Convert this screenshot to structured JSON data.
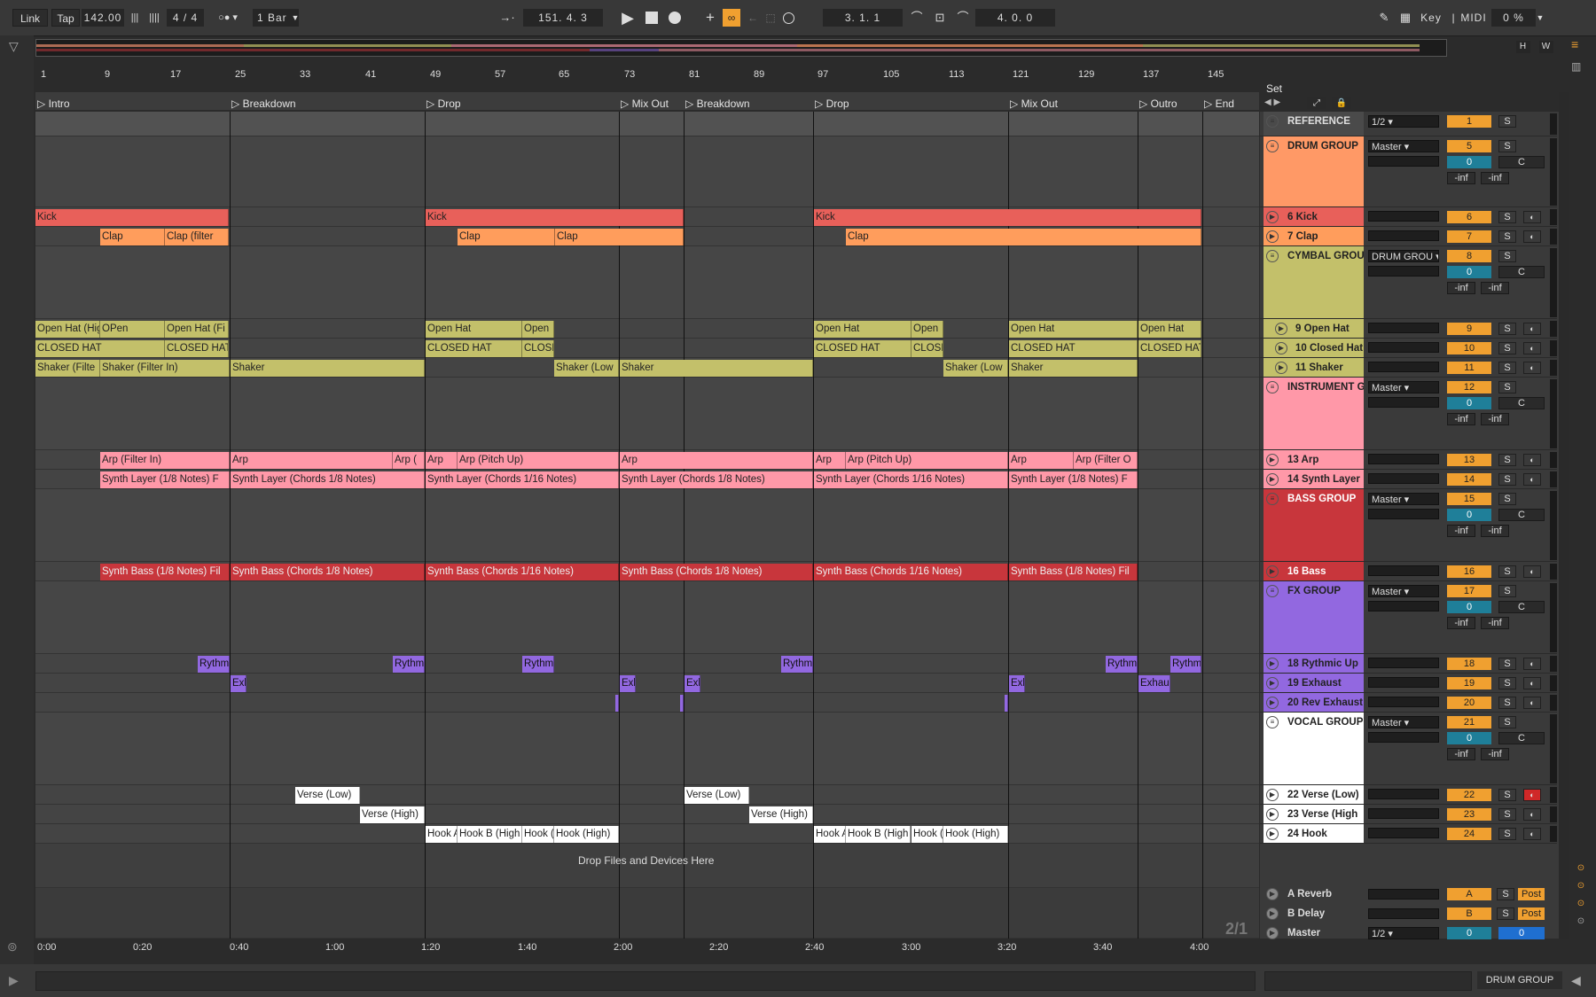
{
  "transport": {
    "link": "Link",
    "tap": "Tap",
    "tempo": "142.00",
    "signature": "4 / 4",
    "quantize": "1 Bar",
    "position": "151.   4.   3",
    "loop_start": "3.   1.   1",
    "loop_length": "4.   0.   0",
    "key": "Key",
    "midi": "MIDI",
    "cpu": "0 %",
    "overview_h": "H",
    "overview_w": "W"
  },
  "arrangement": {
    "set_label": "Set",
    "bars": [
      "1",
      "9",
      "17",
      "25",
      "33",
      "41",
      "49",
      "57",
      "65",
      "73",
      "81",
      "89",
      "97",
      "105",
      "113",
      "121",
      "129",
      "137",
      "145"
    ],
    "locators": [
      "Intro",
      "Breakdown",
      "Drop",
      "Mix Out",
      "Breakdown",
      "Drop",
      "Mix Out",
      "Outro",
      "End"
    ],
    "drop_hint": "Drop Files and Devices Here",
    "page_indicator": "2/1",
    "times": [
      "0:00",
      "0:20",
      "0:40",
      "1:00",
      "1:20",
      "1:40",
      "2:00",
      "2:20",
      "2:40",
      "3:00",
      "3:20",
      "3:40",
      "4:00"
    ]
  },
  "clips": {
    "kick": [
      "Kick",
      "Kick",
      "Kick"
    ],
    "clap": [
      "Clap",
      "Clap (filter",
      "Clap",
      "Clap",
      "Clap"
    ],
    "openhat": [
      "Open Hat (Highpass",
      "OPen",
      "Open Hat (Fi",
      "Open Hat",
      "Open",
      "Open Hat",
      "Open",
      "Open Hat",
      "Open Hat"
    ],
    "closedhat": [
      "CLOSED HAT",
      "CLOSED HAT",
      "CLOSED HAT",
      "CLOSE",
      "CLOSED HAT",
      "CLOSE",
      "CLOSED HAT",
      "CLOSED HAT"
    ],
    "shaker": [
      "Shaker (Filte",
      "Shaker (Filter In)",
      "Shaker",
      "Shaker (Low",
      "Shaker",
      "Shaker (Low",
      "Shaker"
    ],
    "arp": [
      "Arp (Filter In)",
      "Arp",
      "Arp (",
      "Arp",
      "Arp (Pitch Up)",
      "Arp",
      "Arp",
      "Arp (Pitch Up)",
      "Arp",
      "Arp (Filter O"
    ],
    "synthlayer": [
      "Synth Layer (1/8 Notes) F",
      "Synth Layer (Chords 1/8 Notes)",
      "Synth Layer (Chords 1/16 Notes)",
      "Synth Layer (Chords 1/8 Notes)",
      "Synth Layer (Chords 1/16 Notes)",
      "Synth Layer (1/8 Notes) F"
    ],
    "bass": [
      "Synth Bass (1/8 Notes) Fil",
      "Synth Bass (Chords 1/8 Notes)",
      "Synth Bass (Chords 1/16 Notes)",
      "Synth Bass (Chords 1/8 Notes)",
      "Synth Bass (Chords 1/16 Notes)",
      "Synth Bass (1/8 Notes) Fil"
    ],
    "rythmic": [
      "Rythm",
      "Rythm",
      "Rythm",
      "Rythm",
      "Rythm",
      "Rythm"
    ],
    "exhaust": [
      "Exl",
      "Exl",
      "Exl",
      "Exl",
      "Exhau"
    ],
    "verselow": [
      "Verse (Low)",
      "Verse (Low)"
    ],
    "versehigh": [
      "Verse (High)",
      "Verse (High)"
    ],
    "hook": [
      "Hook A",
      "Hook B (High",
      "Hook (",
      "Hook (High)",
      "Hook A",
      "Hook B (High",
      "Hook (",
      "Hook (High)"
    ]
  },
  "mixer": {
    "tracks": [
      {
        "name": "REFERENCE",
        "route": "1/2",
        "num": "1"
      },
      {
        "name": "DRUM GROUP",
        "route": "Master",
        "num": "5",
        "vol": "0",
        "c": "C",
        "inf1": "-inf",
        "inf2": "-inf"
      },
      {
        "name": "6 Kick",
        "num": "6"
      },
      {
        "name": "7 Clap",
        "num": "7"
      },
      {
        "name": "CYMBAL GROU",
        "route": "DRUM GROU",
        "num": "8",
        "vol": "0",
        "c": "C",
        "inf1": "-inf",
        "inf2": "-inf"
      },
      {
        "name": "9 Open Hat",
        "num": "9"
      },
      {
        "name": "10 Closed Hat",
        "num": "10"
      },
      {
        "name": "11 Shaker",
        "num": "11"
      },
      {
        "name": "INSTRUMENT G",
        "route": "Master",
        "num": "12",
        "vol": "0",
        "c": "C",
        "inf1": "-inf",
        "inf2": "-inf"
      },
      {
        "name": "13 Arp",
        "num": "13"
      },
      {
        "name": "14 Synth Layer",
        "num": "14"
      },
      {
        "name": "BASS GROUP",
        "route": "Master",
        "num": "15",
        "vol": "0",
        "c": "C",
        "inf1": "-inf",
        "inf2": "-inf"
      },
      {
        "name": "16 Bass",
        "num": "16"
      },
      {
        "name": "FX GROUP",
        "route": "Master",
        "num": "17",
        "vol": "0",
        "c": "C",
        "inf1": "-inf",
        "inf2": "-inf"
      },
      {
        "name": "18 Rythmic Up",
        "num": "18"
      },
      {
        "name": "19 Exhaust",
        "num": "19"
      },
      {
        "name": "20 Rev Exhaust",
        "num": "20"
      },
      {
        "name": "VOCAL GROUP",
        "route": "Master",
        "num": "21",
        "vol": "0",
        "c": "C",
        "inf1": "-inf",
        "inf2": "-inf"
      },
      {
        "name": "22 Verse (Low)",
        "num": "22"
      },
      {
        "name": "23 Verse (High",
        "num": "23"
      },
      {
        "name": "24 Hook",
        "num": "24"
      }
    ],
    "returns": [
      {
        "name": "A Reverb",
        "num": "A",
        "post": "Post"
      },
      {
        "name": "B Delay",
        "num": "B",
        "post": "Post"
      },
      {
        "name": "Master",
        "route": "1/2",
        "num": "0",
        "vol": "0"
      }
    ],
    "solo": "S"
  },
  "status": {
    "selected_track": "DRUM GROUP"
  },
  "colors": {
    "drum": "#ff9966",
    "kick": "#e8605a",
    "clap": "#ff9d5c",
    "cymbal": "#c3c06a",
    "instrument": "#ff98a8",
    "bass": "#c8363c",
    "fx": "#9268e0",
    "vocal": "#ffffff",
    "accent": "#f0a030"
  }
}
